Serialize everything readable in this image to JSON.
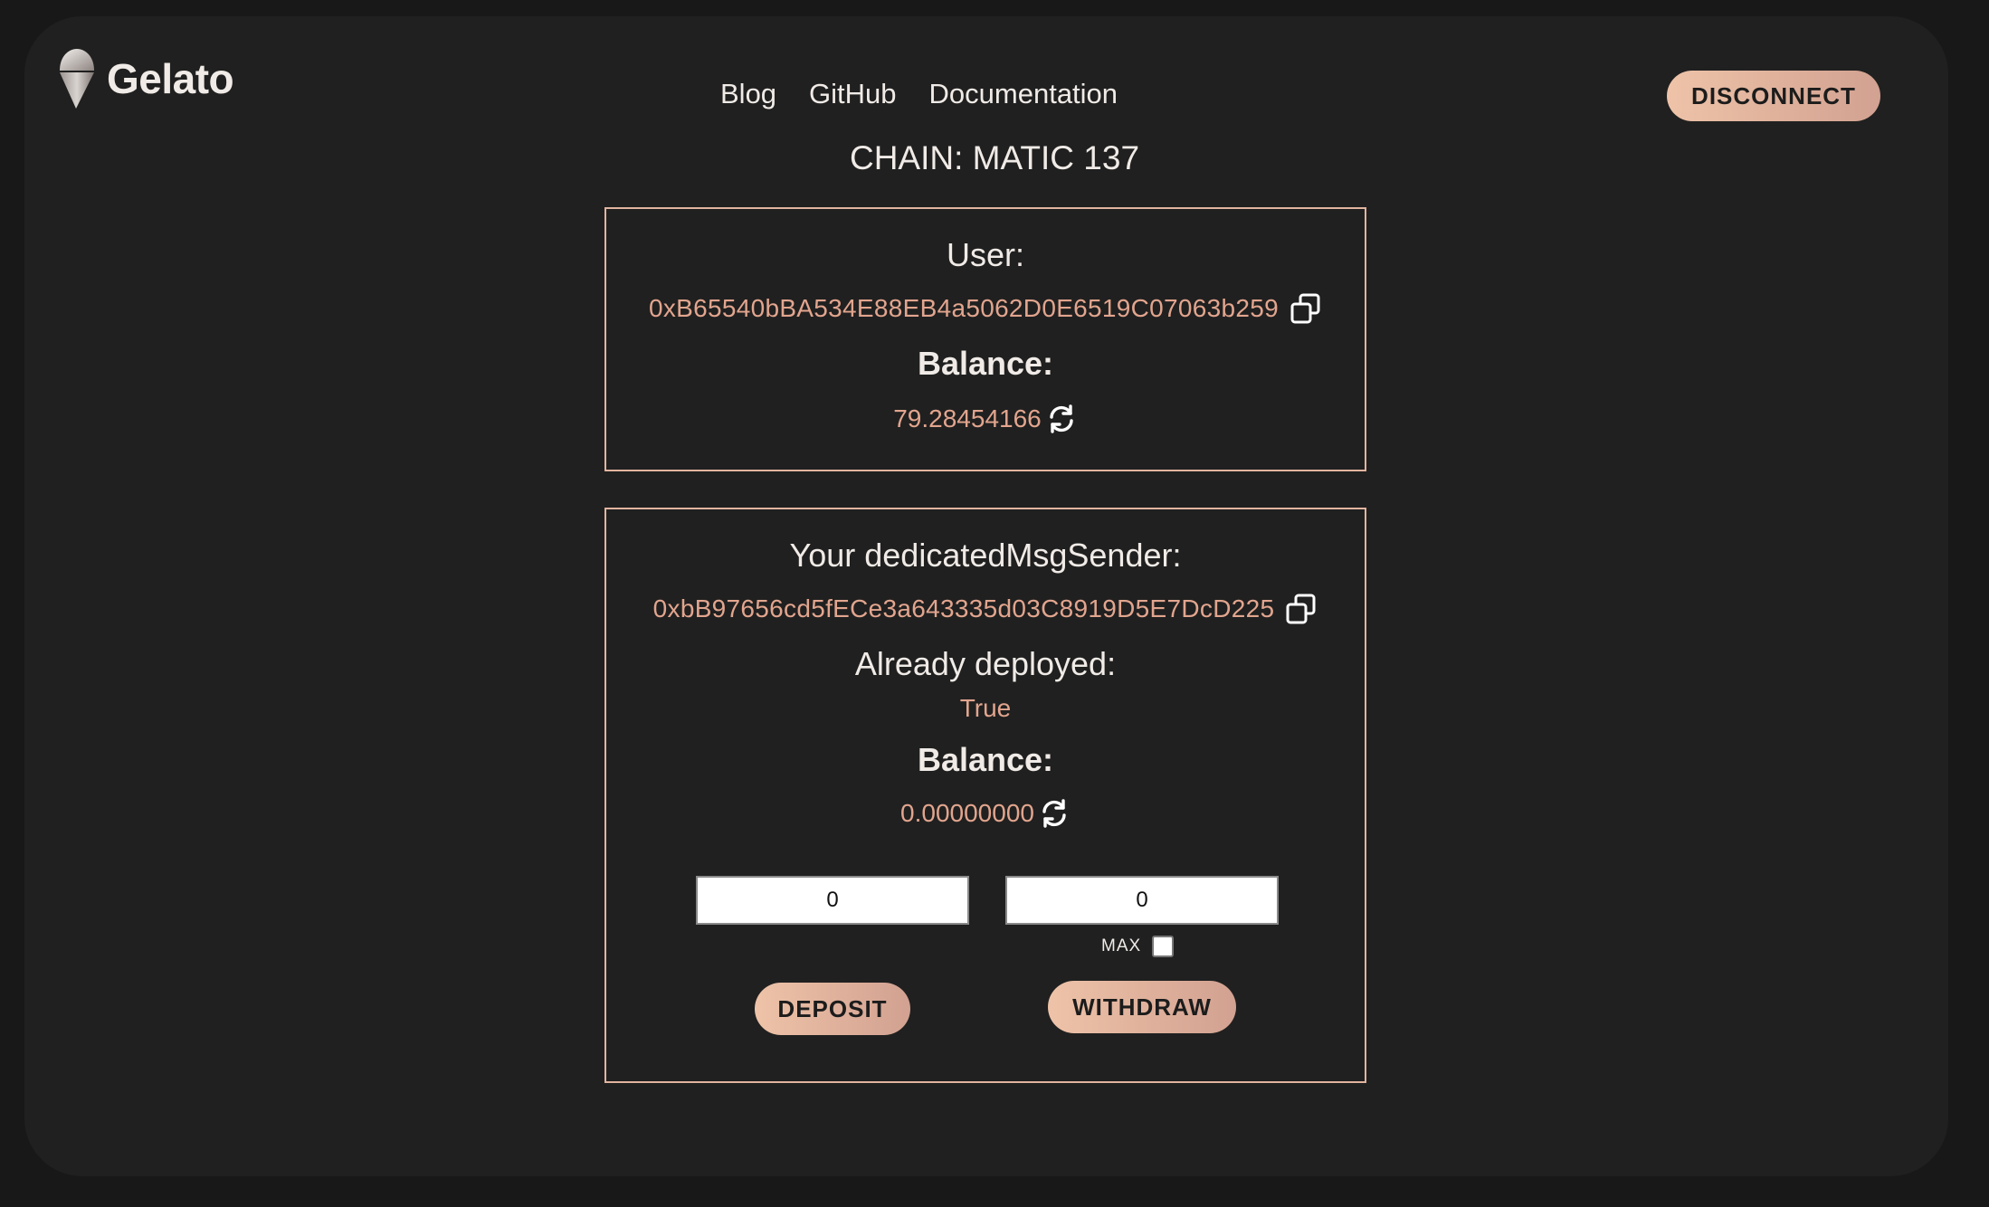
{
  "brand": {
    "name": "Gelato",
    "logo_icon": "ice-cream-icon"
  },
  "nav": {
    "blog": "Blog",
    "github": "GitHub",
    "docs": "Documentation"
  },
  "header": {
    "disconnect_label": "DISCONNECT"
  },
  "chain": {
    "text": "CHAIN: MATIC 137"
  },
  "user": {
    "label": "User:",
    "address": "0xB65540bBA534E88EB4a5062D0E6519C07063b259",
    "balance_label": "Balance:",
    "balance": "79.28454166"
  },
  "sender": {
    "label": "Your dedicatedMsgSender:",
    "address": "0xbB97656cd5fECe3a643335d03C8919D5E7DcD225",
    "deployed_label": "Already deployed:",
    "deployed_value": "True",
    "balance_label": "Balance:",
    "balance": "0.00000000",
    "deposit_value": "0",
    "withdraw_value": "0",
    "max_label": "MAX",
    "deposit_label": "DEPOSIT",
    "withdraw_label": "WITHDRAW"
  },
  "colors": {
    "accent": "#e2a58e",
    "border": "#e2b49f",
    "panel": "#202020",
    "background": "#181818",
    "text": "#f0ebe7"
  },
  "icons": {
    "copy": "copy-icon",
    "refresh": "refresh-icon"
  }
}
